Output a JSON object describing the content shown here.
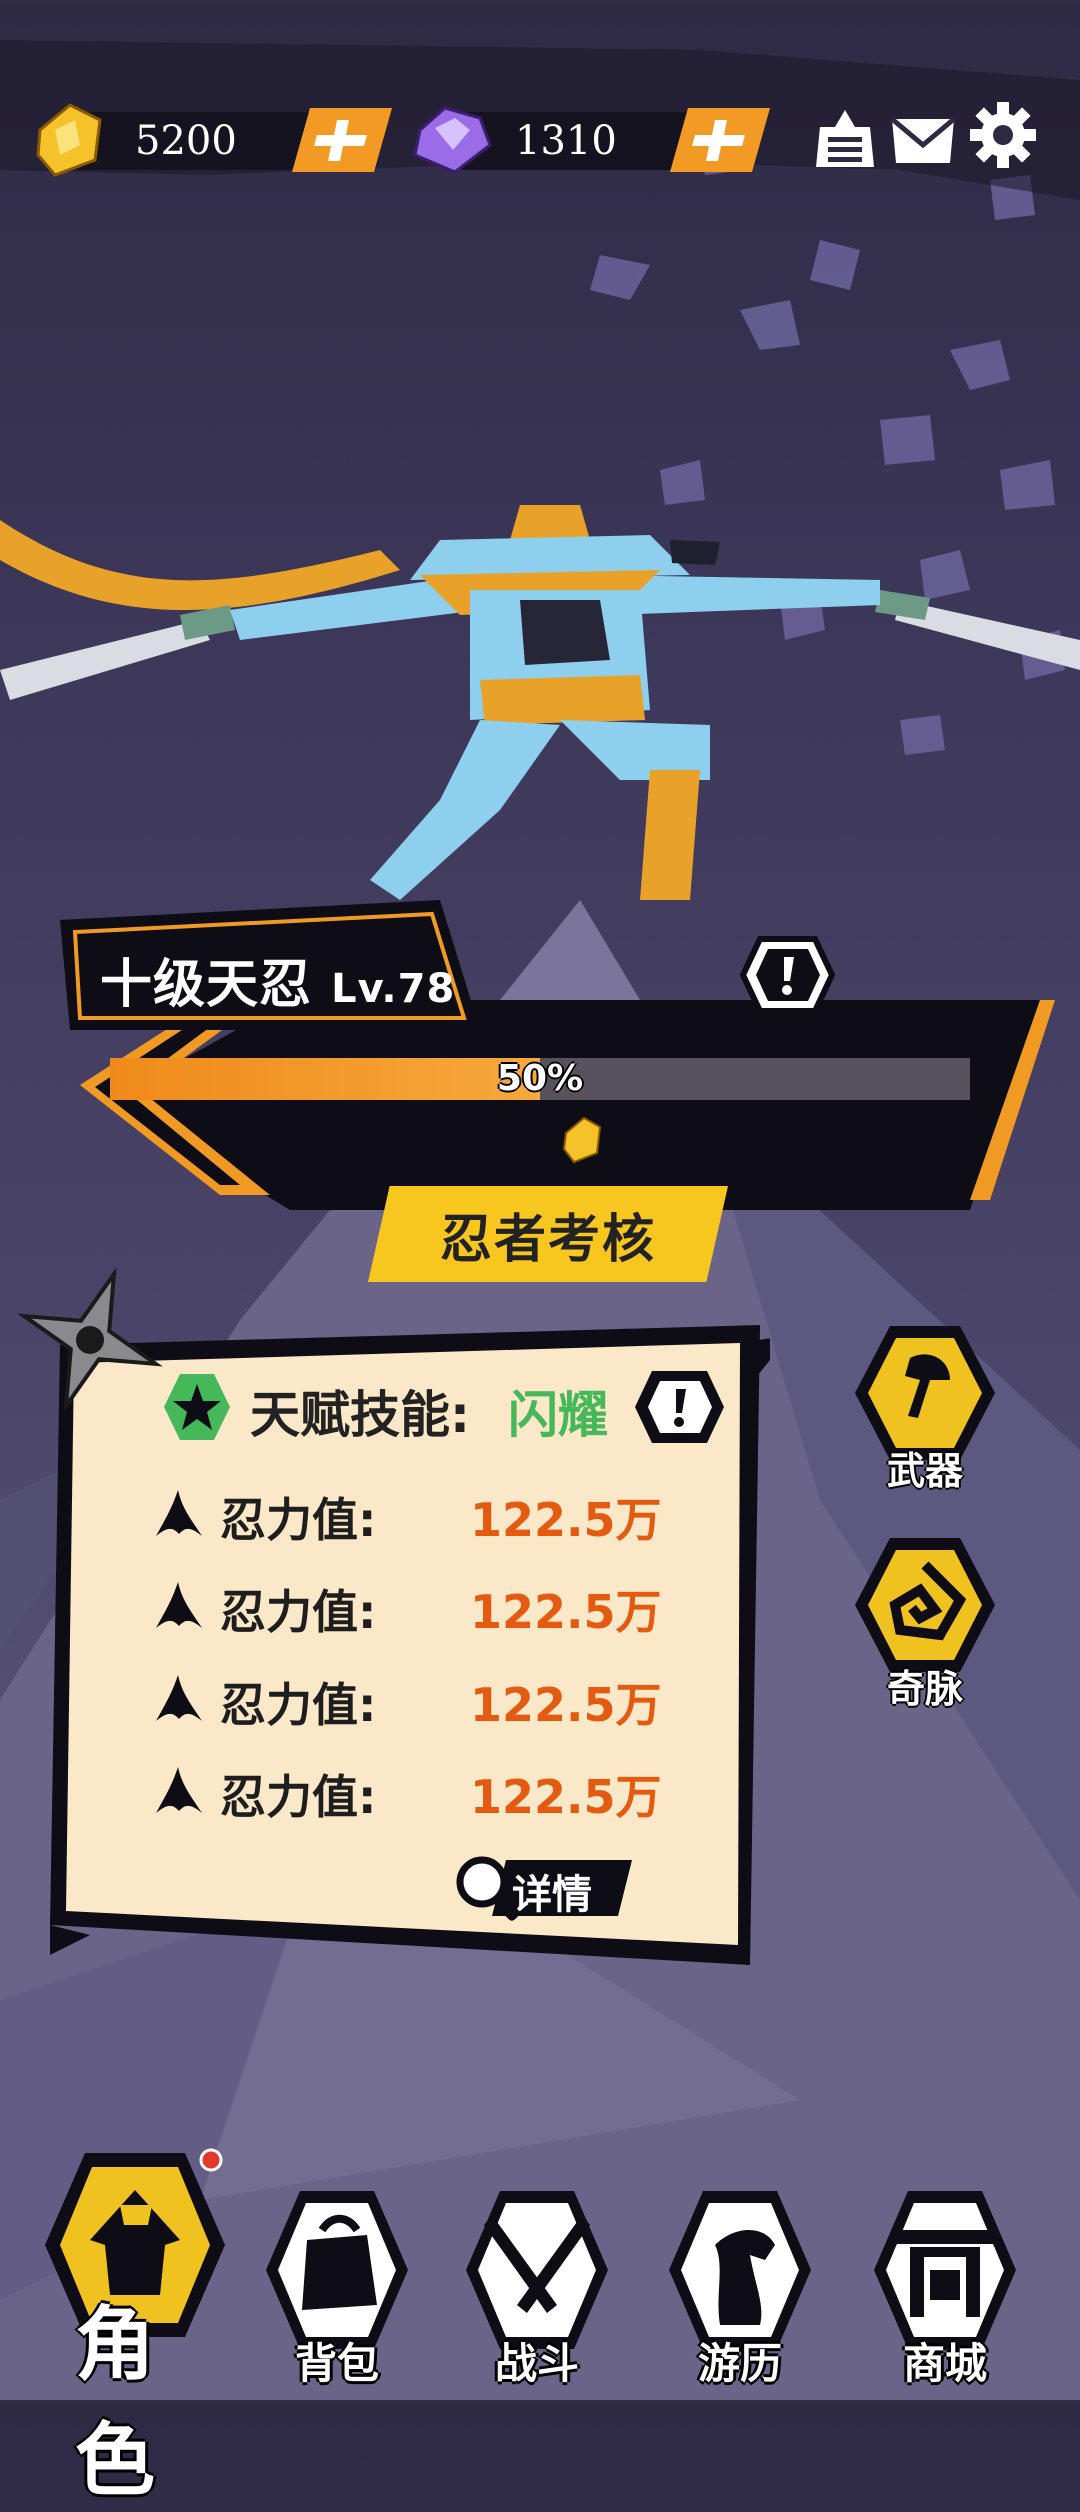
{
  "currency": {
    "gold": {
      "icon": "gold-ingot-icon",
      "value": "5200"
    },
    "gems": {
      "icon": "purple-gem-icon",
      "value": "1310"
    }
  },
  "top_icons": [
    "notice-icon",
    "mail-icon",
    "settings-gear-icon"
  ],
  "character": {
    "title": "十级天忍",
    "level": "Lv.78",
    "progress_percent": 50,
    "progress_text": "50%",
    "exam_button": "忍者考核"
  },
  "stats": {
    "talent_label": "天赋技能:",
    "talent_value": "闪耀",
    "rows": [
      {
        "label": "忍力值:",
        "value": "122.5万"
      },
      {
        "label": "忍力值:",
        "value": "122.5万"
      },
      {
        "label": "忍力值:",
        "value": "122.5万"
      },
      {
        "label": "忍力值:",
        "value": "122.5万"
      }
    ],
    "detail_button": "详情"
  },
  "side_buttons": [
    {
      "label": "武器",
      "icon": "axe-weapon-icon"
    },
    {
      "label": "奇脉",
      "icon": "meridian-spiral-icon"
    }
  ],
  "nav": [
    {
      "label": "角色",
      "icon": "ninja-character-icon",
      "active": true
    },
    {
      "label": "背包",
      "icon": "backpack-icon",
      "active": false
    },
    {
      "label": "战斗",
      "icon": "crossed-swords-icon",
      "active": false
    },
    {
      "label": "游历",
      "icon": "horse-travel-icon",
      "active": false
    },
    {
      "label": "商城",
      "icon": "shop-gate-icon",
      "active": false
    }
  ],
  "colors": {
    "accent_orange": "#f39a24",
    "button_yellow": "#f7c61f",
    "stat_value": "#e35a10",
    "talent_green": "#45b85a",
    "panel_bg": "#fbe8c8"
  }
}
